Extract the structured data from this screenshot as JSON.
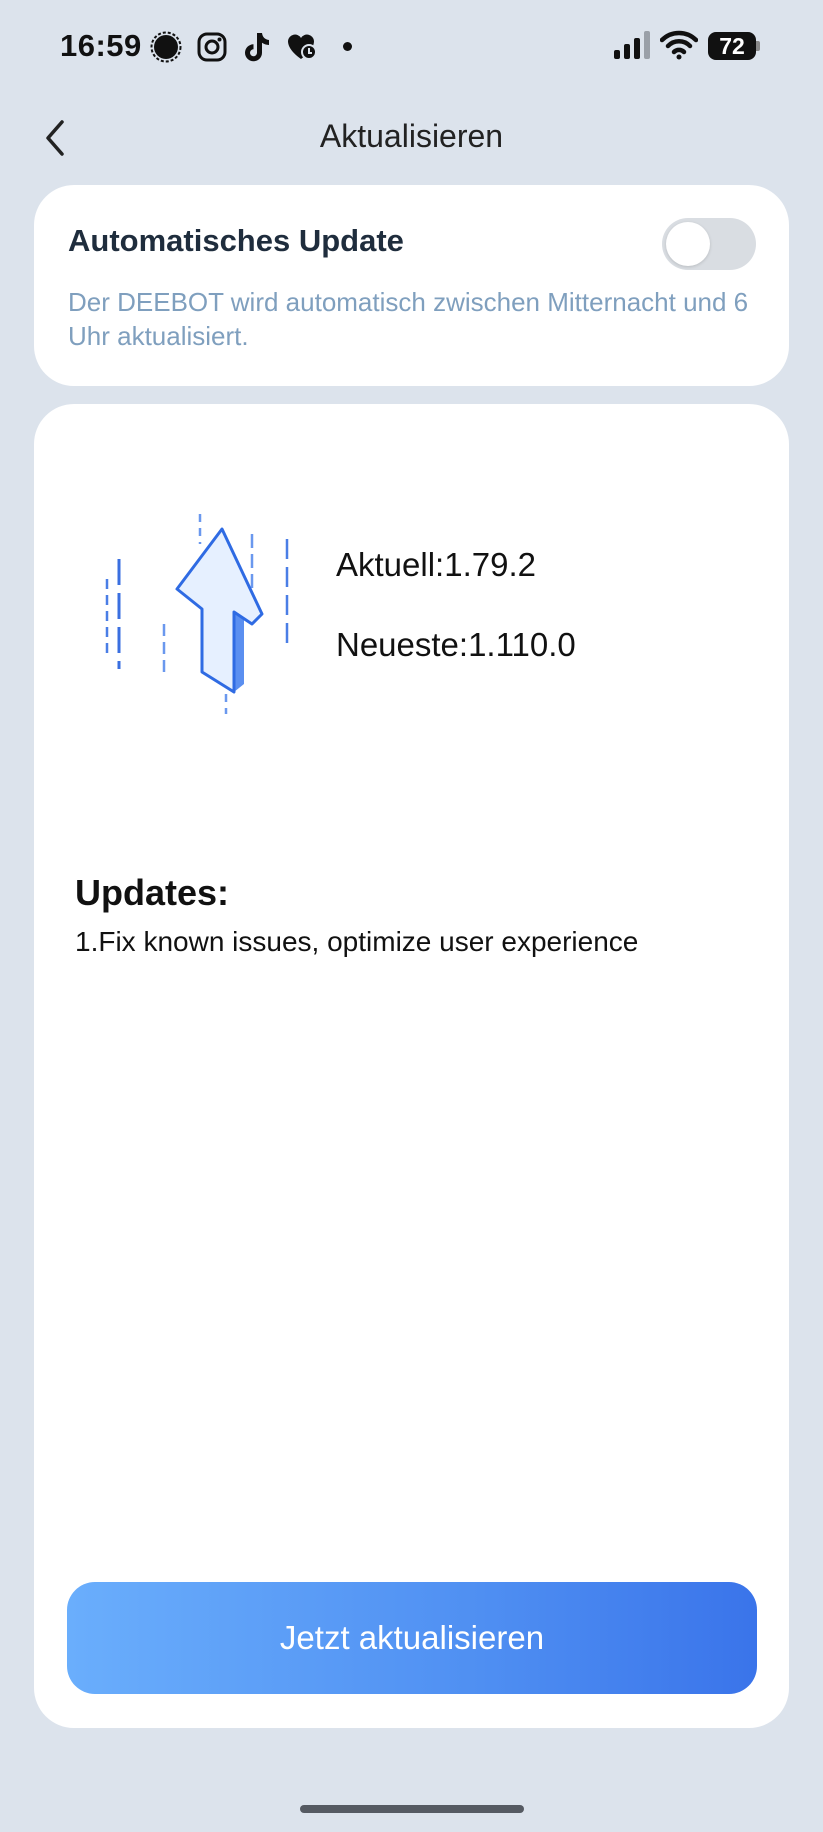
{
  "status_bar": {
    "time": "16:59",
    "battery": "72",
    "icons": [
      "signal-messenger-icon",
      "instagram-icon",
      "tiktok-icon",
      "heart-icon",
      "notification-dot",
      "cell-signal-icon",
      "wifi-icon",
      "battery-icon"
    ]
  },
  "header": {
    "title": "Aktualisieren",
    "back_icon": "chevron-left-icon"
  },
  "auto_update": {
    "title": "Automatisches Update",
    "description": "Der DEEBOT wird automatisch zwischen Mitternacht und 6 Uhr aktualisiert.",
    "enabled": false
  },
  "firmware": {
    "illustration_icon": "upload-arrow-icon",
    "current": "Aktuell:1.79.2",
    "latest": "Neueste:1.110.0"
  },
  "updates": {
    "heading": "Updates:",
    "items": [
      "1.Fix known issues, optimize user experience"
    ]
  },
  "actions": {
    "update_now": "Jetzt aktualisieren"
  },
  "colors": {
    "background": "#dce3ec",
    "card": "#ffffff",
    "accent_start": "#6aaefc",
    "accent_end": "#3a74ea",
    "description_text": "#7f9fbe",
    "toggle_off": "#d9dde2"
  }
}
